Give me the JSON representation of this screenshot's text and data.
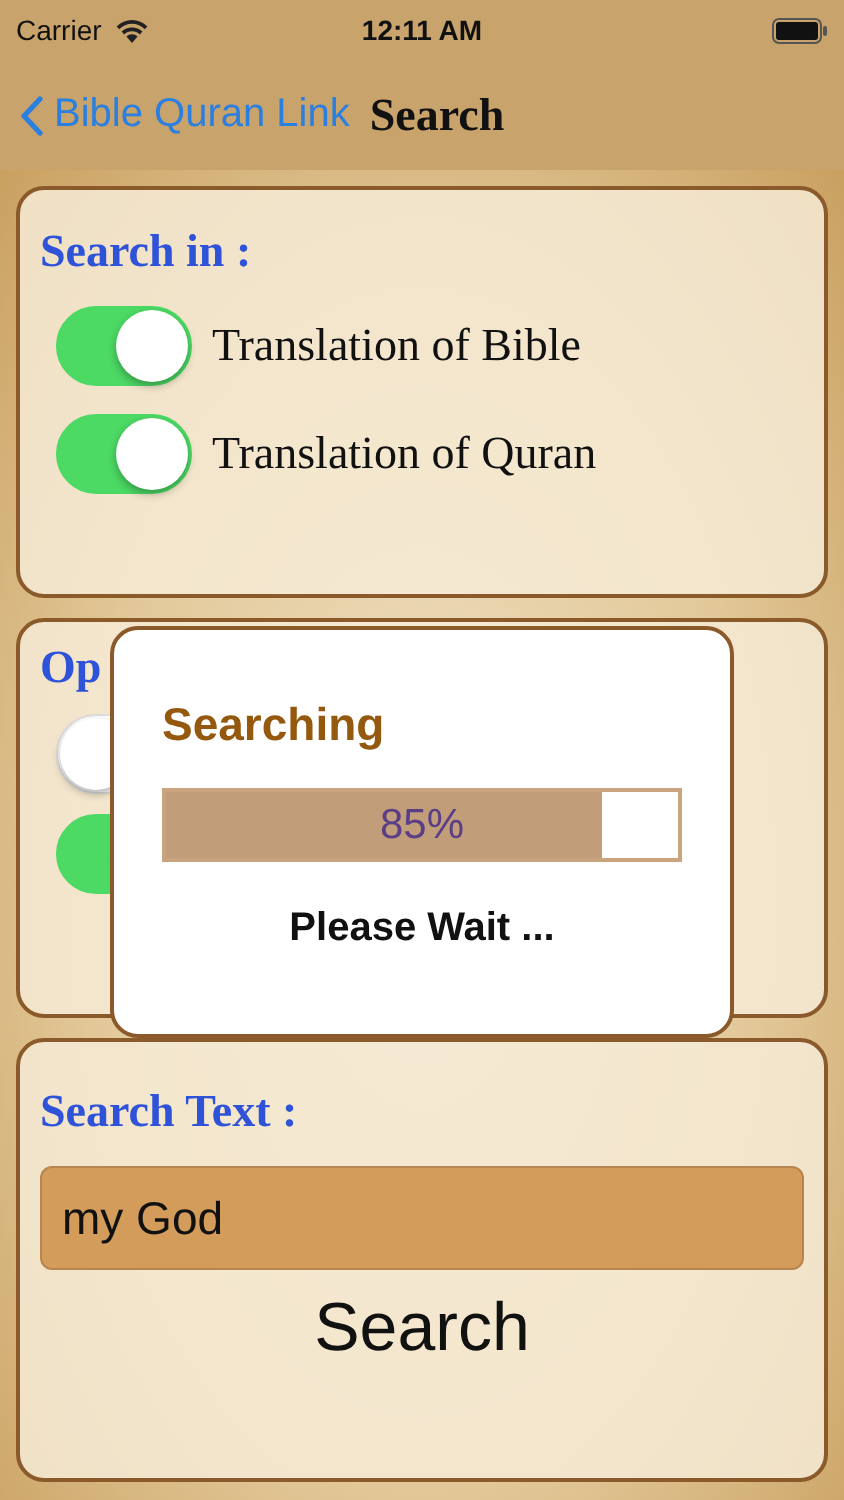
{
  "status_bar": {
    "carrier": "Carrier",
    "time": "12:11 AM"
  },
  "nav": {
    "back": "Bible Quran Link",
    "title": "Search"
  },
  "search_in": {
    "heading": "Search in :",
    "toggles": [
      {
        "label": "Translation of Bible",
        "on": true
      },
      {
        "label": "Translation of Quran",
        "on": true
      }
    ]
  },
  "options": {
    "heading": "Op",
    "toggles": [
      {
        "on": false
      },
      {
        "on": true
      }
    ]
  },
  "search_text": {
    "heading": "Search Text :",
    "value": "my God",
    "button": "Search"
  },
  "dialog": {
    "title": "Searching",
    "level": 0.85,
    "reading": "85%",
    "message": "Please Wait ..."
  }
}
